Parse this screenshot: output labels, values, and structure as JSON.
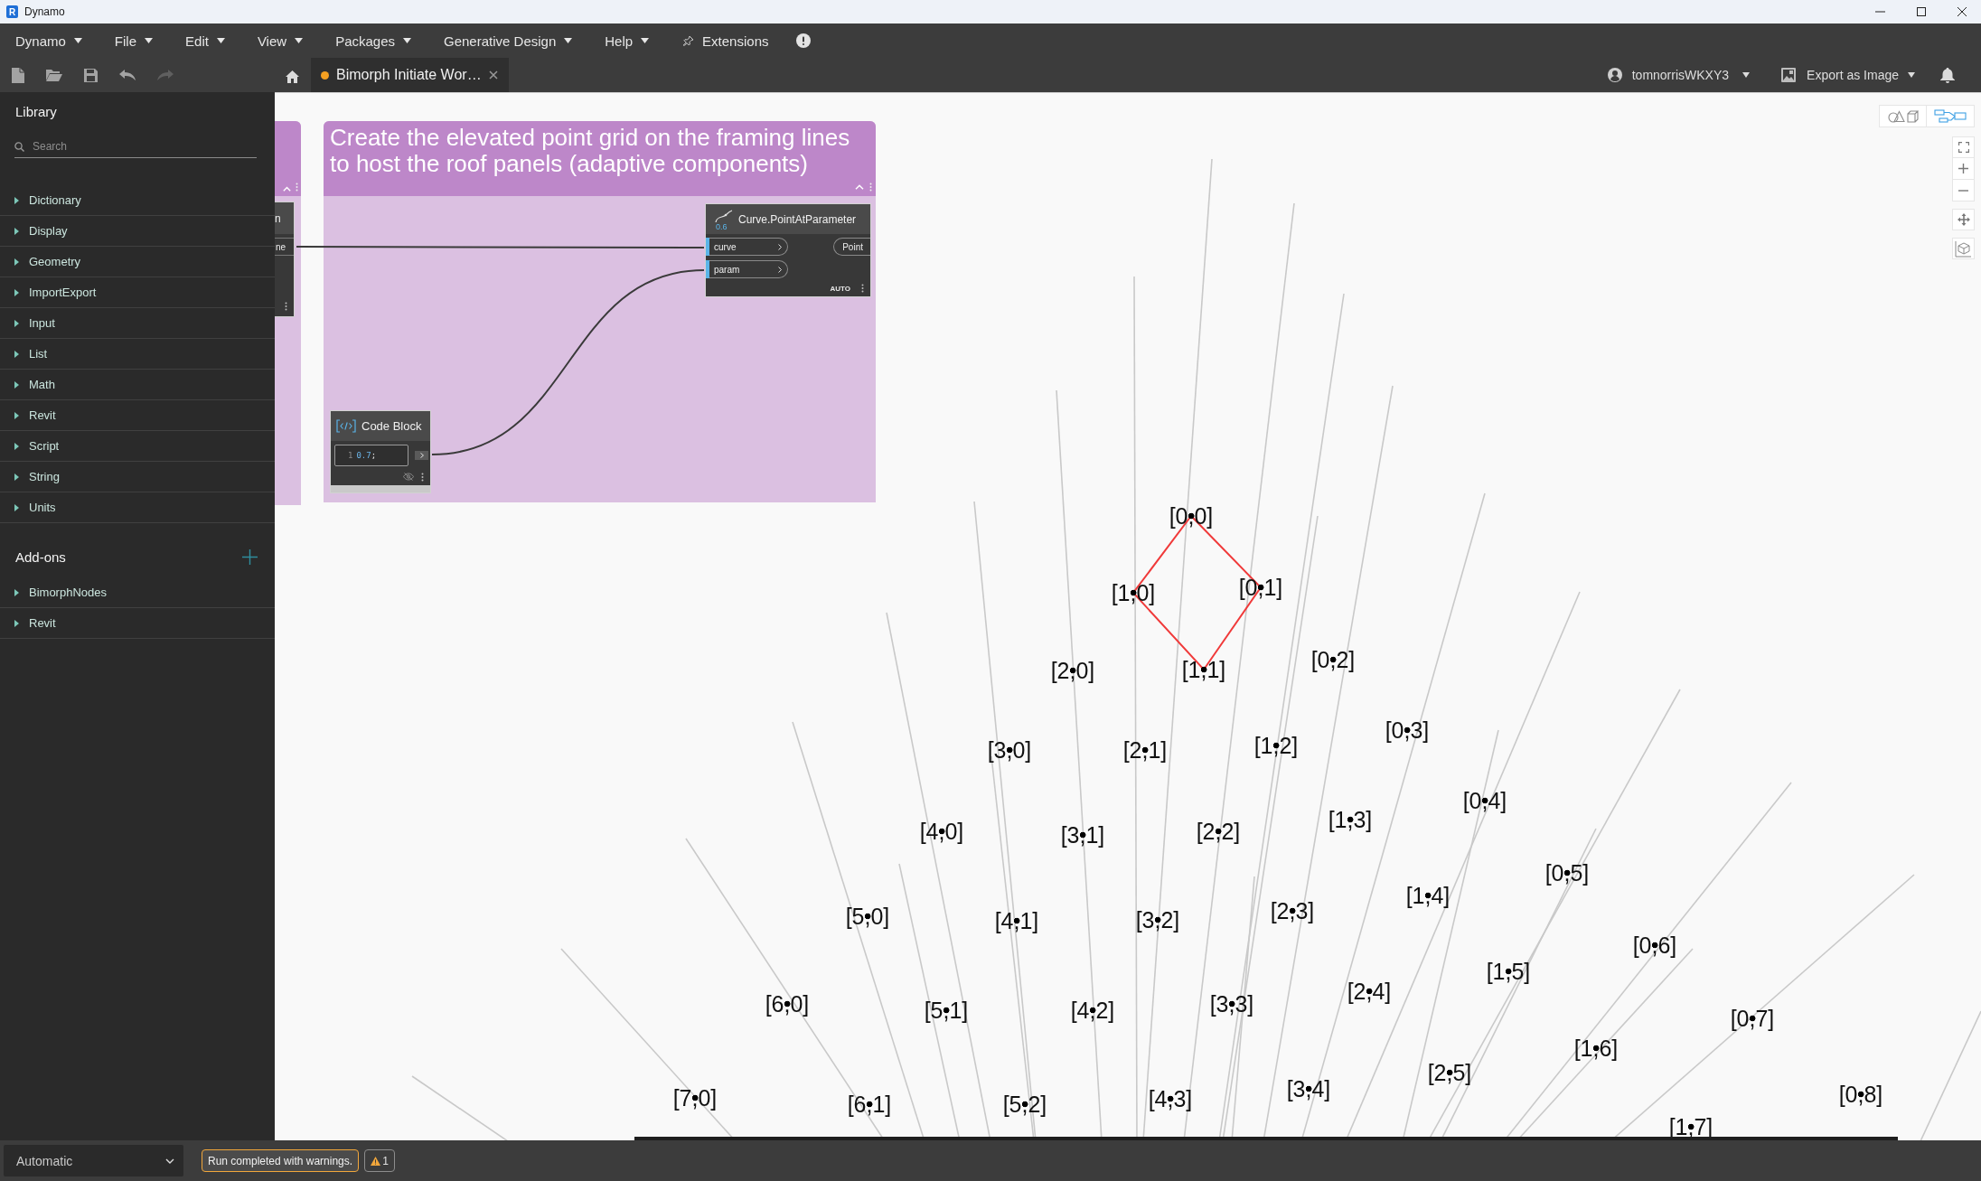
{
  "window": {
    "icon_letter": "R",
    "title": "Dynamo"
  },
  "menu": [
    {
      "kind": "dropdown",
      "label": "Dynamo"
    },
    {
      "kind": "dropdown",
      "label": "File"
    },
    {
      "kind": "dropdown",
      "label": "Edit"
    },
    {
      "kind": "dropdown",
      "label": "View"
    },
    {
      "kind": "dropdown",
      "label": "Packages"
    },
    {
      "kind": "dropdown",
      "label": "Generative Design"
    },
    {
      "kind": "dropdown",
      "label": "Help"
    },
    {
      "kind": "pinned",
      "label": "Extensions"
    },
    {
      "kind": "info"
    }
  ],
  "toolbar": [
    {
      "kind": "new",
      "disabled": false
    },
    {
      "kind": "open",
      "disabled": false
    },
    {
      "kind": "save",
      "disabled": false
    },
    {
      "kind": "undo",
      "disabled": false
    },
    {
      "kind": "redo",
      "disabled": true
    }
  ],
  "tabs": [
    {
      "label": "Bimorph Initiate Wor…",
      "selected": true,
      "unsaved": true
    }
  ],
  "account": {
    "name": "tomnorrisWKXY3"
  },
  "export": {
    "label": "Export as Image"
  },
  "library": {
    "title": "Library",
    "search": {
      "placeholder": "Search"
    },
    "items": [
      {
        "label": "Dictionary",
        "expanded": false
      },
      {
        "label": "Display",
        "expanded": false
      },
      {
        "label": "Geometry",
        "expanded": false
      },
      {
        "label": "ImportExport",
        "expanded": false
      },
      {
        "label": "Input",
        "expanded": false
      },
      {
        "label": "List",
        "expanded": false
      },
      {
        "label": "Math",
        "expanded": false
      },
      {
        "label": "Revit",
        "expanded": false
      },
      {
        "label": "Script",
        "expanded": false
      },
      {
        "label": "String",
        "expanded": false
      },
      {
        "label": "Units",
        "expanded": false
      }
    ]
  },
  "addons": {
    "title": "Add-ons",
    "items": [
      {
        "label": "BimorphNodes",
        "expanded": false
      },
      {
        "label": "Revit",
        "expanded": false
      }
    ]
  },
  "canvas": {
    "partial_group": {
      "node": {
        "title": "n",
        "output": "ne"
      }
    },
    "group": {
      "title": "Create the elevated point grid on the framing lines to host the roof panels (adaptive components)",
      "nodes": [
        {
          "kind": "function",
          "title": "Curve.PointAtParameter",
          "icon_label": "0.6",
          "inputs": [
            {
              "name": "curve",
              "connected": true
            },
            {
              "name": "param",
              "connected": true
            }
          ],
          "outputs": [
            "Point"
          ],
          "lacing": "AUTO"
        },
        {
          "kind": "code",
          "title": "Code Block",
          "lines": [
            {
              "number": "1",
              "tokens": [
                {
                  "kind": "number",
                  "text": "0.7"
                },
                {
                  "kind": "punctuation",
                  "text": ";"
                }
              ]
            }
          ],
          "preview_hidden": true
        }
      ]
    },
    "points": [
      "[0,0]",
      "[1,0]",
      "[0,1]",
      "[2,0]",
      "[1,1]",
      "[0,2]",
      "[3,0]",
      "[2,1]",
      "[1,2]",
      "[0,3]",
      "[1,3]",
      "[0,4]",
      "[4,0]",
      "[3,1]",
      "[2,2]",
      "[1,4]",
      "[0,5]",
      "[5,0]",
      "[4,1]",
      "[3,2]",
      "[2,3]",
      "[0,6]",
      "[2,4]",
      "[1,5]",
      "[6,0]",
      "[5,1]",
      "[4,2]",
      "[3,3]",
      "[0,7]",
      "[1,6]",
      "[7,0]",
      "[6,1]",
      "[5,2]",
      "[4,3]",
      "[3,4]",
      "[2,5]",
      "[0,8]",
      "[1,7]"
    ],
    "view_toggle": [
      {
        "kind": "geometry",
        "selected": false
      },
      {
        "kind": "graph",
        "selected": true
      }
    ]
  },
  "status_bar": {
    "run_mode": "Automatic",
    "message": "Run completed with warnings.",
    "warnings": "1"
  }
}
